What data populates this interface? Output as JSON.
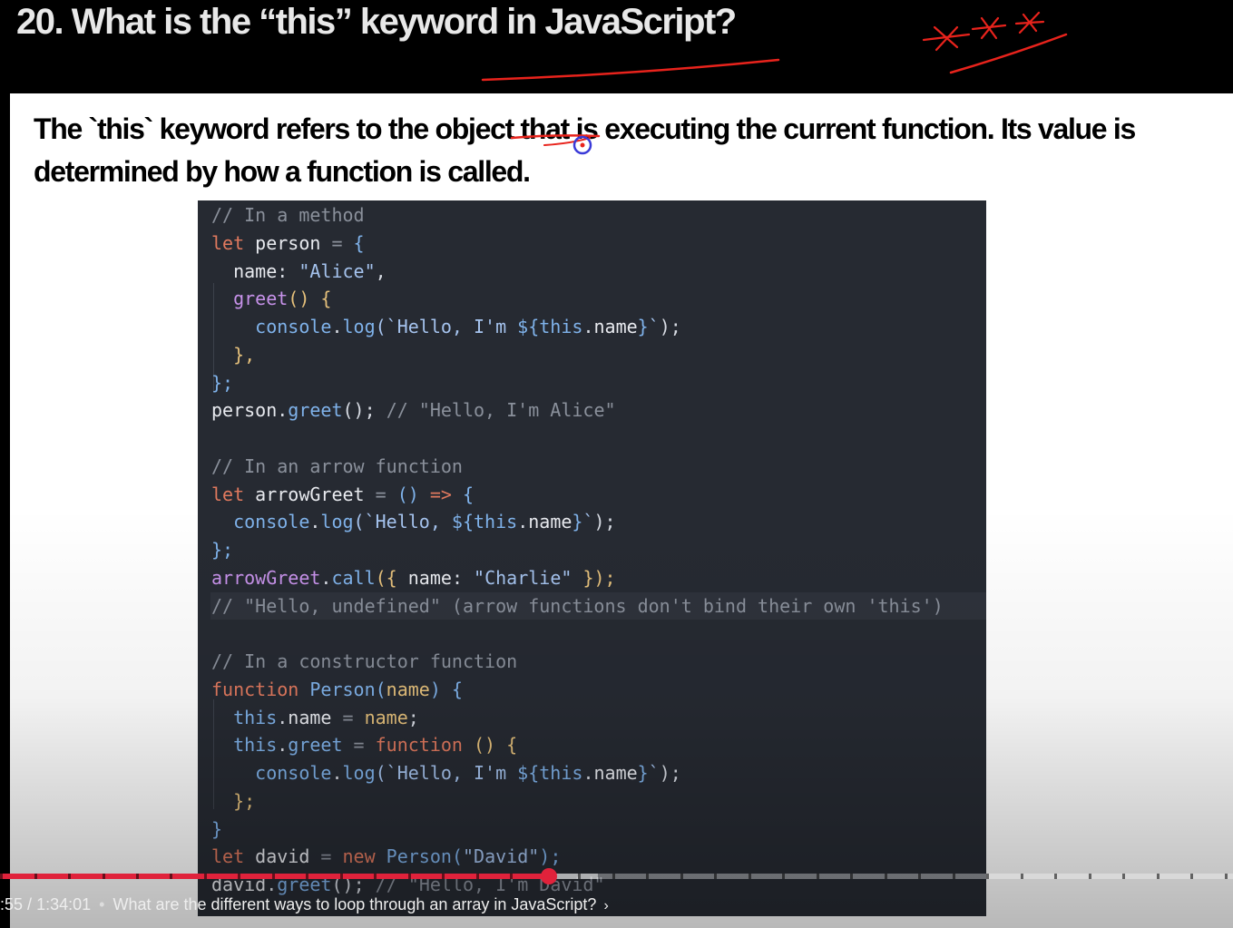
{
  "slide": {
    "title": "20. What is the “this” keyword in JavaScript?",
    "description": "The `this` keyword refers to the object that is executing the current function. Its value is determined by how a function is called."
  },
  "code": {
    "lines": [
      [
        {
          "t": "// In a method",
          "c": "c"
        }
      ],
      [
        {
          "t": "let",
          "c": "k"
        },
        {
          "t": " person ",
          "c": "v"
        },
        {
          "t": "=",
          "c": "o"
        },
        {
          "t": " {",
          "c": "f"
        }
      ],
      [
        {
          "t": "  name",
          "c": "v"
        },
        {
          "t": ": ",
          "c": "p"
        },
        {
          "t": "\"Alice\"",
          "c": "s"
        },
        {
          "t": ",",
          "c": "p"
        }
      ],
      [
        {
          "t": "  greet",
          "c": "m"
        },
        {
          "t": "() {",
          "c": "g"
        }
      ],
      [
        {
          "t": "    console",
          "c": "f"
        },
        {
          "t": ".",
          "c": "p"
        },
        {
          "t": "log",
          "c": "f"
        },
        {
          "t": "(`Hello, I'm ",
          "c": "s"
        },
        {
          "t": "${",
          "c": "f"
        },
        {
          "t": "this",
          "c": "f"
        },
        {
          "t": ".",
          "c": "p"
        },
        {
          "t": "name",
          "c": "v"
        },
        {
          "t": "}",
          "c": "f"
        },
        {
          "t": "`",
          "c": "s"
        },
        {
          "t": ");",
          "c": "p"
        }
      ],
      [
        {
          "t": "  },",
          "c": "g"
        }
      ],
      [
        {
          "t": "};",
          "c": "f"
        }
      ],
      [
        {
          "t": "person",
          "c": "v"
        },
        {
          "t": ".",
          "c": "p"
        },
        {
          "t": "greet",
          "c": "f"
        },
        {
          "t": "(); ",
          "c": "p"
        },
        {
          "t": "// \"Hello, I'm Alice\"",
          "c": "c"
        }
      ],
      [],
      [
        {
          "t": "// In an arrow function",
          "c": "c"
        }
      ],
      [
        {
          "t": "let",
          "c": "k"
        },
        {
          "t": " arrowGreet ",
          "c": "v"
        },
        {
          "t": "=",
          "c": "o"
        },
        {
          "t": " () ",
          "c": "f"
        },
        {
          "t": "=>",
          "c": "k"
        },
        {
          "t": " {",
          "c": "f"
        }
      ],
      [
        {
          "t": "  console",
          "c": "f"
        },
        {
          "t": ".",
          "c": "p"
        },
        {
          "t": "log",
          "c": "f"
        },
        {
          "t": "(`Hello, ",
          "c": "s"
        },
        {
          "t": "${",
          "c": "f"
        },
        {
          "t": "this",
          "c": "f"
        },
        {
          "t": ".",
          "c": "p"
        },
        {
          "t": "name",
          "c": "v"
        },
        {
          "t": "}",
          "c": "f"
        },
        {
          "t": "`",
          "c": "s"
        },
        {
          "t": ");",
          "c": "p"
        }
      ],
      [
        {
          "t": "};",
          "c": "f"
        }
      ],
      [
        {
          "t": "arrowGreet",
          "c": "m"
        },
        {
          "t": ".",
          "c": "p"
        },
        {
          "t": "call",
          "c": "f"
        },
        {
          "t": "({ ",
          "c": "g"
        },
        {
          "t": "name",
          "c": "v"
        },
        {
          "t": ": ",
          "c": "p"
        },
        {
          "t": "\"Charlie\"",
          "c": "s"
        },
        {
          "t": " });",
          "c": "g"
        }
      ],
      [
        {
          "t": "// \"Hello, undefined\" (arrow functions don't bind their own 'this')",
          "c": "c"
        }
      ],
      [],
      [
        {
          "t": "// In a constructor function",
          "c": "c"
        }
      ],
      [
        {
          "t": "function",
          "c": "k"
        },
        {
          "t": " Person",
          "c": "f"
        },
        {
          "t": "(",
          "c": "f"
        },
        {
          "t": "name",
          "c": "g"
        },
        {
          "t": ") {",
          "c": "f"
        }
      ],
      [
        {
          "t": "  this",
          "c": "f"
        },
        {
          "t": ".",
          "c": "p"
        },
        {
          "t": "name ",
          "c": "v"
        },
        {
          "t": "=",
          "c": "o"
        },
        {
          "t": " name",
          "c": "g"
        },
        {
          "t": ";",
          "c": "p"
        }
      ],
      [
        {
          "t": "  this",
          "c": "f"
        },
        {
          "t": ".",
          "c": "p"
        },
        {
          "t": "greet ",
          "c": "f"
        },
        {
          "t": "=",
          "c": "o"
        },
        {
          "t": " function",
          "c": "k"
        },
        {
          "t": " () {",
          "c": "g"
        }
      ],
      [
        {
          "t": "    console",
          "c": "f"
        },
        {
          "t": ".",
          "c": "p"
        },
        {
          "t": "log",
          "c": "f"
        },
        {
          "t": "(`Hello, I'm ",
          "c": "s"
        },
        {
          "t": "${",
          "c": "f"
        },
        {
          "t": "this",
          "c": "f"
        },
        {
          "t": ".",
          "c": "p"
        },
        {
          "t": "name",
          "c": "v"
        },
        {
          "t": "}",
          "c": "f"
        },
        {
          "t": "`",
          "c": "s"
        },
        {
          "t": ");",
          "c": "p"
        }
      ],
      [
        {
          "t": "  };",
          "c": "g"
        }
      ],
      [
        {
          "t": "}",
          "c": "f"
        }
      ],
      [
        {
          "t": "let",
          "c": "k"
        },
        {
          "t": " david ",
          "c": "v"
        },
        {
          "t": "=",
          "c": "o"
        },
        {
          "t": " new",
          "c": "k"
        },
        {
          "t": " Person",
          "c": "f"
        },
        {
          "t": "(",
          "c": "f"
        },
        {
          "t": "\"David\"",
          "c": "s"
        },
        {
          "t": ");",
          "c": "f"
        }
      ],
      [
        {
          "t": "david",
          "c": "v"
        },
        {
          "t": ".",
          "c": "p"
        },
        {
          "t": "greet",
          "c": "f"
        },
        {
          "t": "(); ",
          "c": "p"
        },
        {
          "t": "// \"Hello, I'm David\"",
          "c": "c"
        }
      ]
    ]
  },
  "player": {
    "current_time": ":55",
    "duration": "1:34:01",
    "chapter_title": "What are the different ways to loop through an array in JavaScript?",
    "progress_fraction": 0.445,
    "buffered_fraction": 0.485,
    "played_color": "#e0223b"
  },
  "annotations": {
    "ink_color": "#e8231c",
    "pointer_color": "#3a3ad8"
  }
}
